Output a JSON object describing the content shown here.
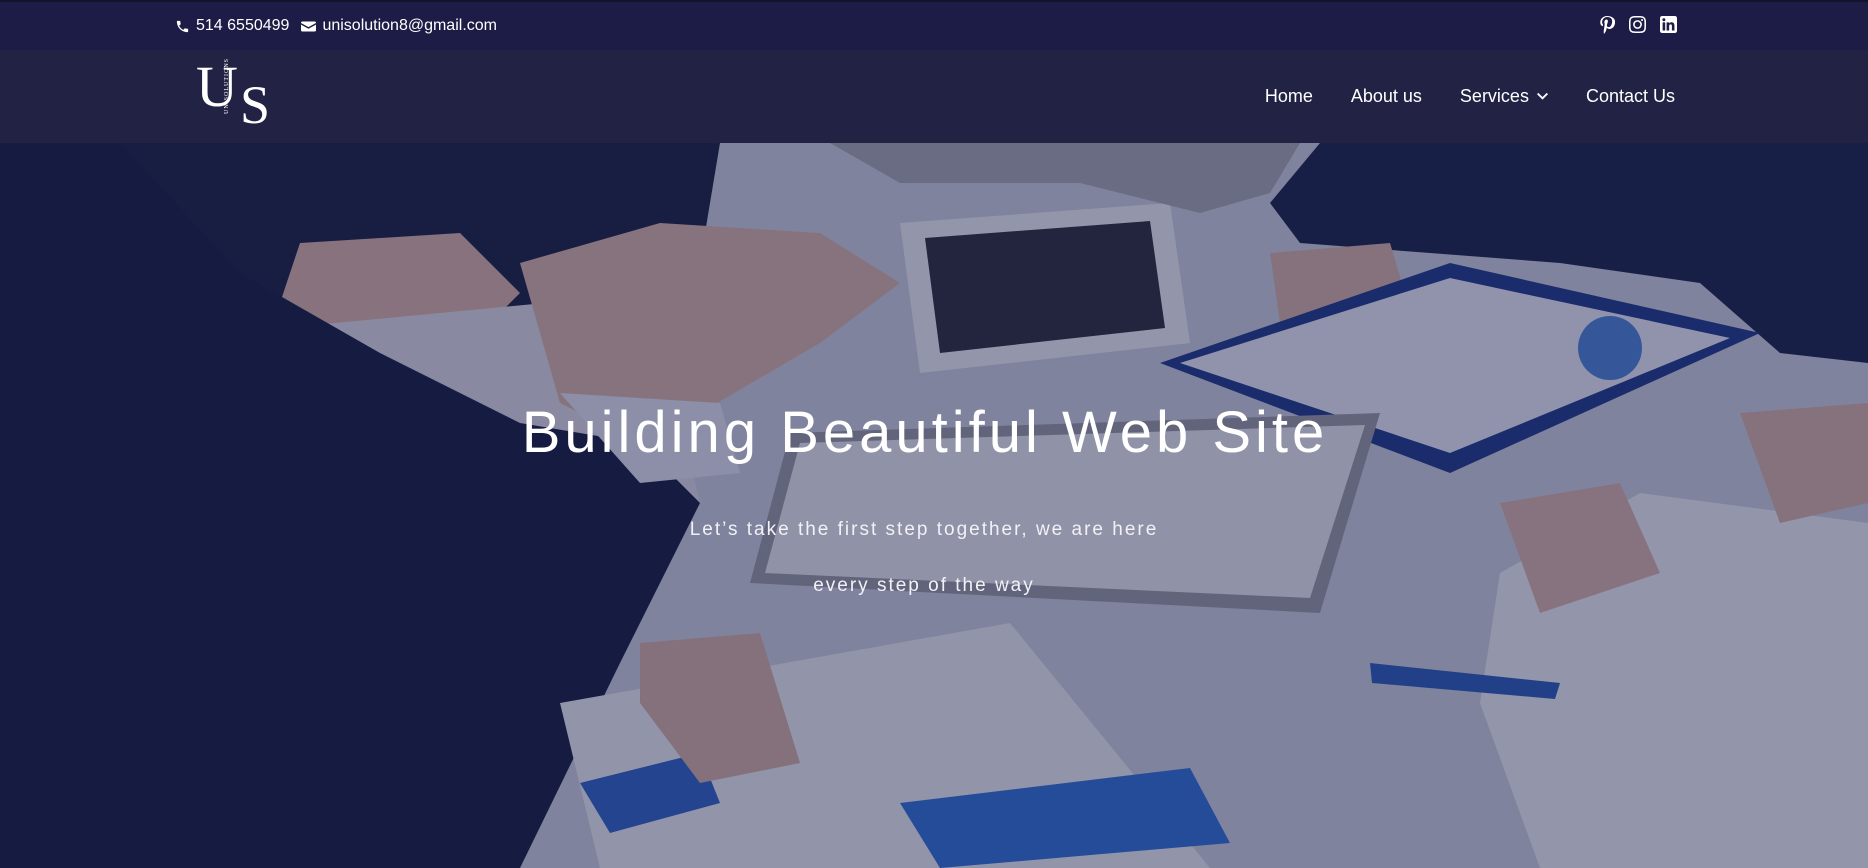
{
  "topbar": {
    "phone": "514 6550499",
    "email": "unisolution8@gmail.com",
    "social_icons": [
      "pinterest-icon",
      "instagram-icon",
      "linkedin-icon"
    ]
  },
  "logo": {
    "letter1": "U",
    "letter2": "S",
    "tagline": "UNISOLUTIONS"
  },
  "nav": {
    "items": [
      "Home",
      "About us",
      "Services",
      "Contact Us"
    ],
    "services_icon": "chevron-down-icon"
  },
  "hero": {
    "title": "Building Beautiful Web Site",
    "subtitle_line1": "Let’s take the first step together, we are here",
    "subtitle_line2": "every step of the way"
  },
  "colors": {
    "topbar_bg": "#1d1c46",
    "navbar_bg": "#222344",
    "overlay": "#161744"
  }
}
